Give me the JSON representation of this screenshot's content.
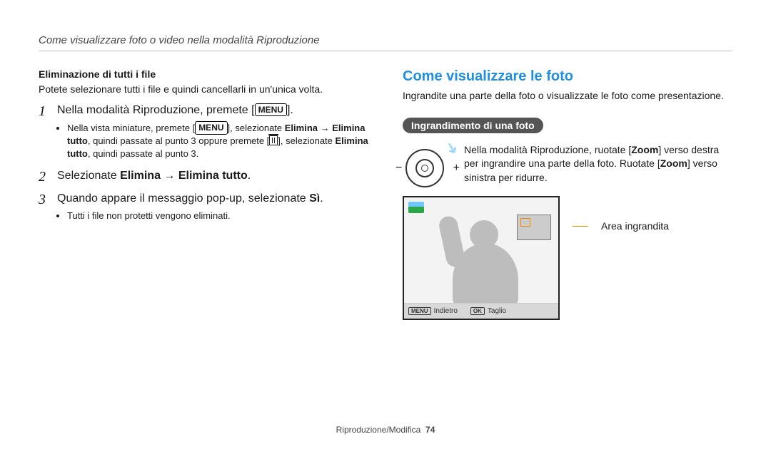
{
  "header": {
    "breadcrumb": "Come visualizzare foto o video nella modalità Riproduzione"
  },
  "left": {
    "subhead": "Eliminazione di tutti i file",
    "intro": "Potete selezionare tutti i file e quindi cancellarli in un'unica volta.",
    "step1": {
      "num": "1",
      "main_pre": "Nella modalità Riproduzione, premete [",
      "menu_label": "MENU",
      "main_post": "].",
      "bullet_pre": "Nella vista miniature, premete [",
      "bullet_mid1": "], selezionate ",
      "bold1": "Elimina",
      "arrow1": " → ",
      "bold2": "Elimina tutto",
      "bullet_mid2": ", quindi passate al punto 3 oppure premete [",
      "bullet_mid3": "], selezionate ",
      "bold3": "Elimina tutto",
      "bullet_tail": ", quindi passate al punto 3."
    },
    "step2": {
      "num": "2",
      "pre": "Selezionate ",
      "bold1": "Elimina",
      "arrow": " → ",
      "bold2": "Elimina tutto",
      "post": "."
    },
    "step3": {
      "num": "3",
      "main_pre": "Quando appare il messaggio pop-up, selezionate ",
      "bold": "Sì",
      "main_post": ".",
      "bullet": "Tutti i file non protetti vengono eliminati."
    }
  },
  "right": {
    "title": "Come visualizzare le foto",
    "intro": "Ingrandite una parte della foto o visualizzate le foto come presentazione.",
    "pill": "Ingrandimento di una foto",
    "dial": {
      "pre": "Nella modalità Riproduzione, ruotate [",
      "zoom1": "Zoom",
      "mid": "] verso destra per ingrandire una parte della foto. Ruotate [",
      "zoom2": "Zoom",
      "post": "] verso sinistra per ridurre."
    },
    "screen": {
      "back_badge": "MENU",
      "back_label": "Indietro",
      "ok_badge": "OK",
      "ok_label": "Taglio"
    },
    "callout": "Area ingrandita"
  },
  "footer": {
    "section": "Riproduzione/Modifica",
    "page": "74"
  }
}
